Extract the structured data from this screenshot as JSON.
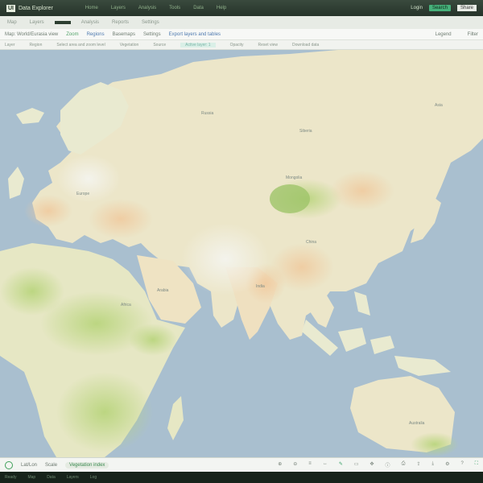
{
  "app": {
    "logo": "UI",
    "title": "Data Explorer",
    "menu": [
      "Home",
      "Layers",
      "Analysis",
      "Tools",
      "Data",
      "Help"
    ],
    "right_items": [
      "Login",
      "Search",
      "Share"
    ]
  },
  "subbar": {
    "tabs": [
      "Map",
      "Layers",
      "Analysis",
      "Reports",
      "Settings"
    ]
  },
  "toolbar": {
    "title": "Map: World/Eurasia view",
    "items": [
      "Zoom",
      "Regions",
      "Basemaps",
      "Settings",
      "Export layers and tables"
    ],
    "right": [
      "Legend",
      "Filter"
    ]
  },
  "infobar": {
    "items": [
      "Layer",
      "Region",
      "Select area and zoom level",
      "Vegetation",
      "Source"
    ],
    "highlight": "Active layer: 1",
    "right": [
      "Opacity",
      "Reset view",
      "Download data"
    ]
  },
  "map_labels": {
    "russia": "Russia",
    "siberia": "Siberia",
    "mongolia": "Mongolia",
    "china": "China",
    "india": "India",
    "arabia": "Arabia",
    "africa": "Africa",
    "europe": "Europe",
    "australia": "Australia",
    "east_region": "Asia"
  },
  "statusbar": {
    "coords": "Lat/Lon",
    "scale": "Scale",
    "mode": "Vegetation index",
    "icons": [
      "zoom-in",
      "zoom-out",
      "layers",
      "measure",
      "draw",
      "select",
      "pan",
      "info",
      "print",
      "share",
      "export",
      "settings",
      "help",
      "full"
    ]
  },
  "footer": {
    "items": [
      "Ready",
      "Map",
      "Data",
      "Layers",
      "Log"
    ]
  },
  "colors": {
    "ocean": "#a9bfcf",
    "land": "#ece6c9",
    "green": "#b9d18a",
    "accent": "#3fa05a"
  }
}
